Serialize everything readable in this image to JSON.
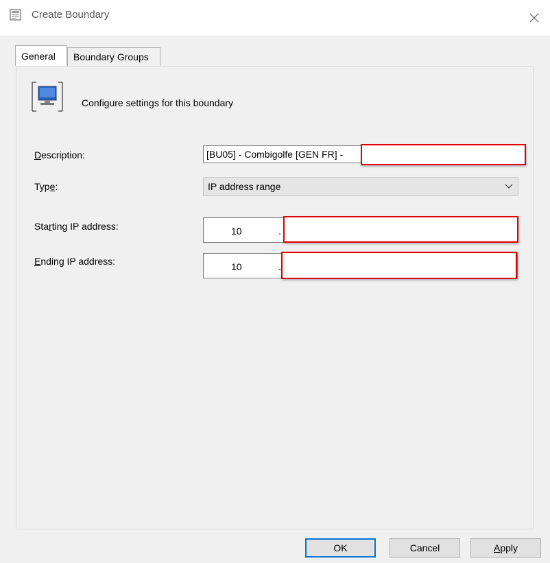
{
  "window": {
    "title": "Create Boundary",
    "close_glyph": "✕"
  },
  "tabs": [
    {
      "label": "General",
      "active": true
    },
    {
      "label": "Boundary Groups",
      "active": false
    }
  ],
  "header": {
    "icon": "computer-boundary-icon",
    "text": "Configure settings for this boundary"
  },
  "form": {
    "description": {
      "label_pre": "",
      "label_accel": "D",
      "label_post": "escription:",
      "value": "[BU05] - Combigolfe [GEN FR] - "
    },
    "type": {
      "label_pre": "Typ",
      "label_accel": "e",
      "label_post": ":",
      "value": "IP address range"
    },
    "starting_ip": {
      "label_pre": "Sta",
      "label_accel": "r",
      "label_post": "ting IP address:",
      "octet1": "10",
      "separator": "."
    },
    "ending_ip": {
      "label_pre": "",
      "label_accel": "E",
      "label_post": "nding IP address:",
      "octet1": "10",
      "separator": "."
    }
  },
  "buttons": {
    "ok": "OK",
    "cancel": "Cancel",
    "apply_accel": "A",
    "apply_rest": "pply"
  },
  "colors": {
    "redaction_border": "#e00000",
    "default_button_border": "#0078d7"
  }
}
